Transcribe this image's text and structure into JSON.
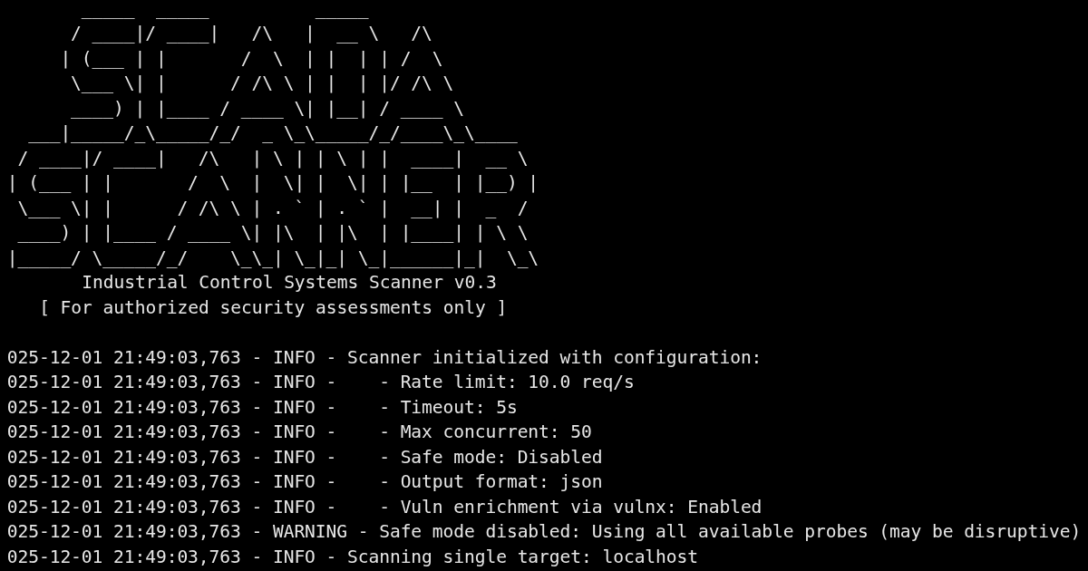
{
  "banner": {
    "art_lines": [
      "       _____  _____          _____",
      "      / ____|/ ____|   /\\   |  __ \\   /\\",
      "     | (___ | |       /  \\  | |  | | /  \\",
      "      \\___ \\| |      / /\\ \\ | |  | |/ /\\ \\",
      "      ____) | |____ / ____ \\| |__| / ____ \\",
      "  ___|_____/_\\_____/_/  _ \\_\\_____/_/____\\_\\____",
      " / ____|/ ____|   /\\   | \\ | | \\ | |  ____|  __ \\",
      "| (___ | |       /  \\  |  \\| |  \\| | |__  | |__) |",
      " \\___ \\| |      / /\\ \\ | . ` | . ` |  __| |  _  /",
      " ____) | |____ / ____ \\| |\\  | |\\  | |____| | \\ \\",
      "|_____/ \\_____/_/    \\_\\_| \\_|_| \\_|______|_|  \\_\\"
    ]
  },
  "subtitle": "Industrial Control Systems Scanner v0.3",
  "notice": "[ For authorized security assessments only ]",
  "log_lines": [
    "025-12-01 21:49:03,763 - INFO - Scanner initialized with configuration:",
    "025-12-01 21:49:03,763 - INFO -    - Rate limit: 10.0 req/s",
    "025-12-01 21:49:03,763 - INFO -    - Timeout: 5s",
    "025-12-01 21:49:03,763 - INFO -    - Max concurrent: 50",
    "025-12-01 21:49:03,763 - INFO -    - Safe mode: Disabled",
    "025-12-01 21:49:03,763 - INFO -    - Output format: json",
    "025-12-01 21:49:03,763 - INFO -    - Vuln enrichment via vulnx: Enabled",
    "025-12-01 21:49:03,763 - WARNING - Safe mode disabled: Using all available probes (may be disruptive)",
    "025-12-01 21:49:03,763 - INFO - Scanning single target: localhost"
  ]
}
